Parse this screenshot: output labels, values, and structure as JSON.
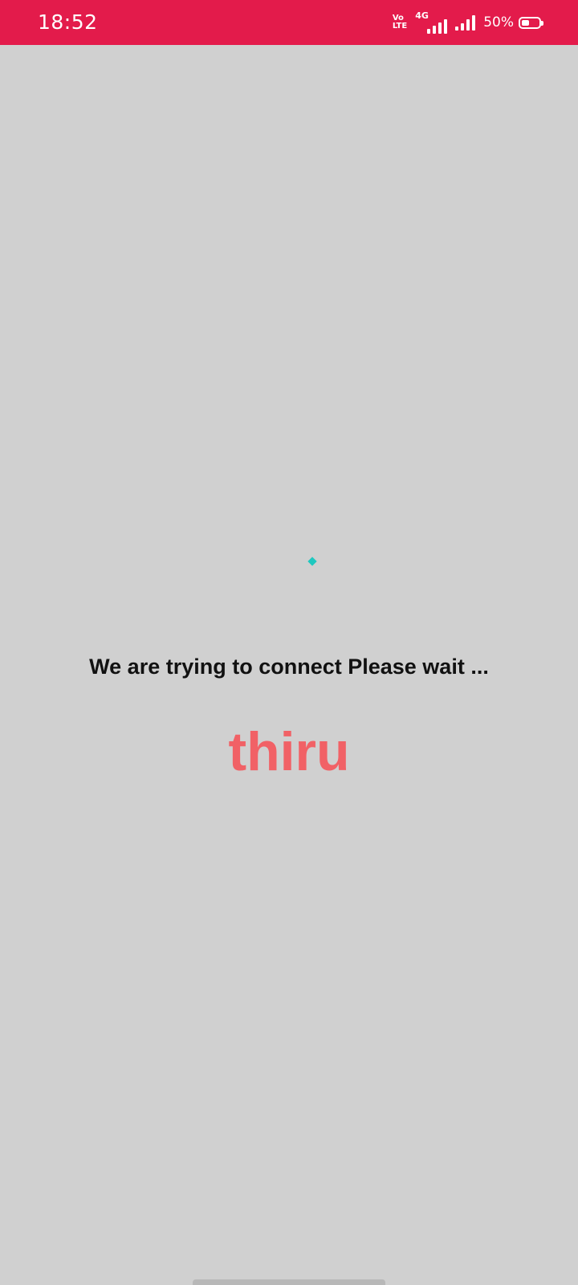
{
  "status_bar": {
    "time": "18:52",
    "volte_top": "Vo",
    "volte_bottom": "LTE",
    "network_type": "4G",
    "battery_text": "50%",
    "battery_level": 0.5,
    "background_color": "#e31b4b"
  },
  "main": {
    "spinner_color": "#1ec8bf",
    "message": "We are trying to connect Please wait ...",
    "brand_name": "thiru",
    "brand_color": "#f16166",
    "background_color": "#d0d0d0"
  }
}
